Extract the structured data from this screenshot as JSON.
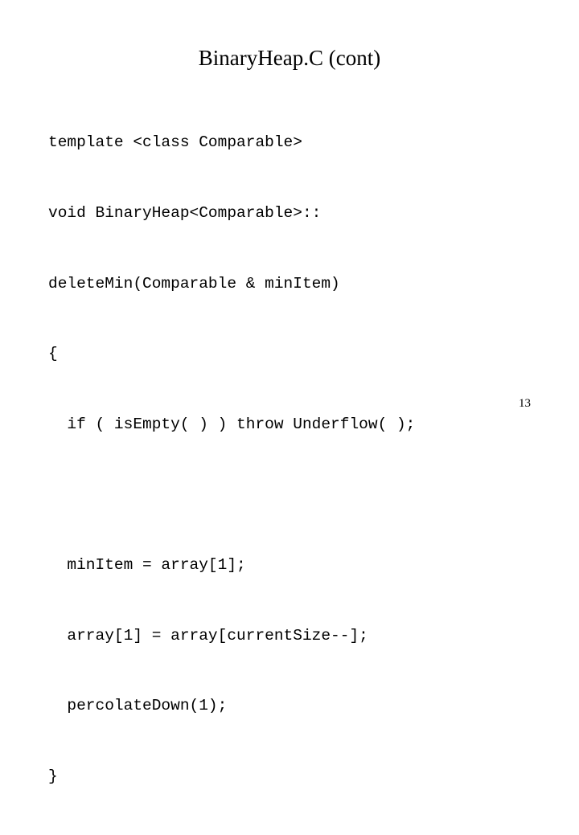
{
  "slide": {
    "title": "BinaryHeap.C (cont)",
    "background_color": "#ffffff",
    "text_color": "#000000",
    "page_number": "13",
    "code": {
      "language": "C++",
      "lines": [
        "template <class Comparable>",
        "void BinaryHeap<Comparable>::",
        "deleteMin(Comparable & minItem)",
        "{",
        "  if ( isEmpty( ) ) throw Underflow( );",
        "",
        "  minItem = array[1];",
        "  array[1] = array[currentSize--];",
        "  percolateDown(1);",
        "}"
      ]
    }
  }
}
